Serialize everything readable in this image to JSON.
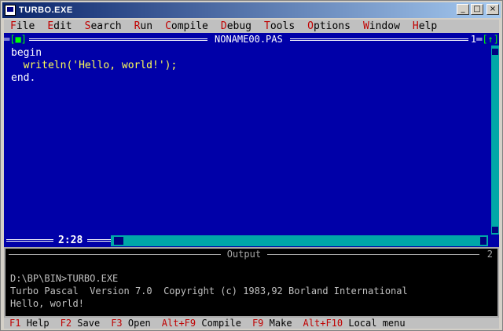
{
  "window": {
    "title": "TURBO.EXE",
    "minimize": "_",
    "maximize": "□",
    "close": "×"
  },
  "menu": [
    {
      "hotkey": "F",
      "rest": "ile"
    },
    {
      "hotkey": "E",
      "rest": "dit"
    },
    {
      "hotkey": "S",
      "rest": "earch"
    },
    {
      "hotkey": "R",
      "rest": "un"
    },
    {
      "hotkey": "C",
      "rest": "ompile"
    },
    {
      "hotkey": "D",
      "rest": "ebug"
    },
    {
      "hotkey": "T",
      "rest": "ools"
    },
    {
      "hotkey": "O",
      "rest": "ptions"
    },
    {
      "hotkey": "W",
      "rest": "indow"
    },
    {
      "hotkey": "H",
      "rest": "elp"
    }
  ],
  "editor": {
    "close_box": "[■]",
    "filename": "NONAME00.PAS",
    "window_number": "1",
    "zoom_box": "[↑]",
    "code_line1": "begin",
    "code_line2": "  writeln('Hello, world!');",
    "code_line3": "end.",
    "cursor_position": "2:28"
  },
  "output": {
    "title": "Output",
    "window_number": "2",
    "line1": "D:\\BP\\BIN>TURBO.EXE",
    "line2": "Turbo Pascal  Version 7.0  Copyright (c) 1983,92 Borland International",
    "line3": "Hello, world!"
  },
  "statusbar": [
    {
      "key": "F1",
      "label": "Help"
    },
    {
      "key": "F2",
      "label": "Save"
    },
    {
      "key": "F3",
      "label": "Open"
    },
    {
      "key": "Alt+F9",
      "label": "Compile"
    },
    {
      "key": "F9",
      "label": "Make"
    },
    {
      "key": "Alt+F10",
      "label": "Local menu"
    }
  ],
  "colors": {
    "editor_bg": "#0000a8",
    "menu_bg": "#c0c0c0",
    "hotkey": "#c00000",
    "code_text": "#ffff55"
  }
}
